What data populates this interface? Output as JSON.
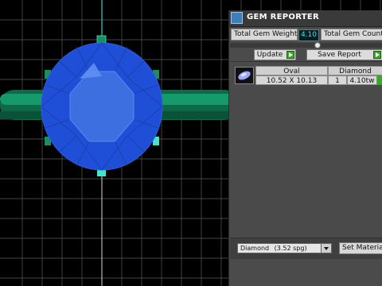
{
  "panel": {
    "title": "GEM REPORTER",
    "total_weight_label": "Total Gem Weight",
    "total_weight_value": "4.10",
    "total_count_label": "Total Gem Count",
    "update_button": "Update",
    "save_report_button": "Save Report",
    "table": {
      "headers": [
        "Oval",
        "Diamond"
      ],
      "rows": [
        {
          "size": "10.52 X 10.13",
          "qty": "1",
          "weight": "4.10tw"
        }
      ]
    },
    "material_select": "Diamond",
    "material_spg": "(3.52 spg)",
    "set_material_button": "Set Material"
  },
  "colors": {
    "gem_blue": "#1f4fd6",
    "band_green": "#0f7a55",
    "prong_cyan": "#3fe6c8",
    "grid_line": "#5a5a5a",
    "panel_bg": "#4b4b4b",
    "value_cyan": "#34e6e6"
  },
  "icons": {
    "title_icon": "gem-reporter-icon",
    "gem_thumb": "oval-gem-icon",
    "play": "green-arrow-icon",
    "dropdown": "chevron-down-icon"
  }
}
